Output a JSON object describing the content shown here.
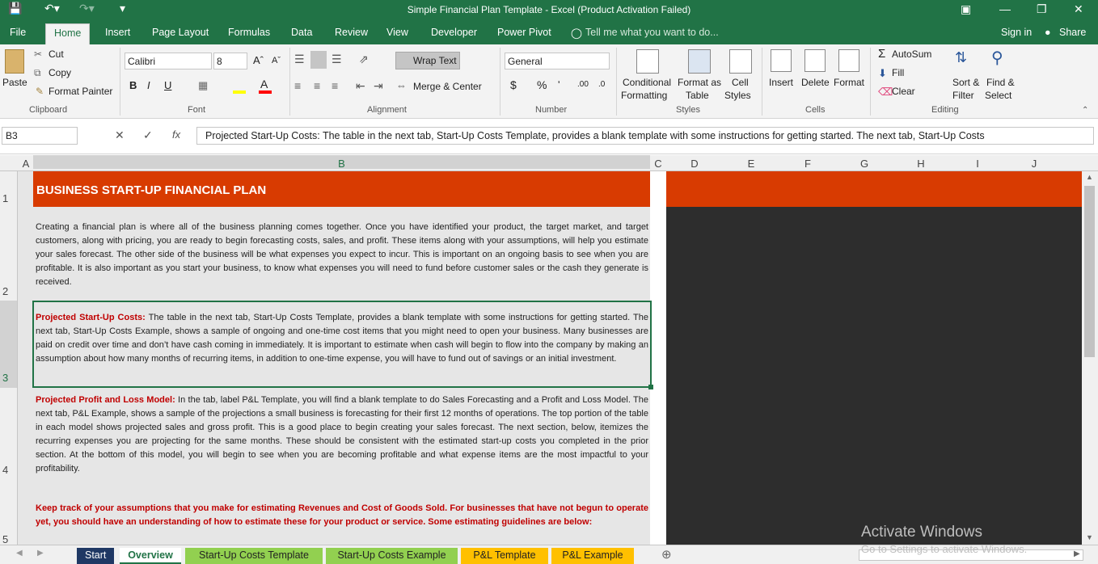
{
  "window": {
    "title": "Simple Financial Plan Template - Excel (Product Activation Failed)"
  },
  "menu": {
    "tabs": [
      "File",
      "Home",
      "Insert",
      "Page Layout",
      "Formulas",
      "Data",
      "Review",
      "View",
      "Developer",
      "Power Pivot"
    ],
    "tell": "Tell me what you want to do...",
    "signin": "Sign in",
    "share": "Share"
  },
  "ribbon": {
    "clipboard": {
      "paste": "Paste",
      "cut": "Cut",
      "copy": "Copy",
      "painter": "Format Painter",
      "label": "Clipboard"
    },
    "font": {
      "name": "Calibri",
      "size": "8",
      "label": "Font"
    },
    "alignment": {
      "wrap": "Wrap Text",
      "merge": "Merge & Center",
      "label": "Alignment"
    },
    "number": {
      "format": "General",
      "label": "Number"
    },
    "styles": {
      "cond1": "Conditional",
      "cond2": "Formatting",
      "fat1": "Format as",
      "fat2": "Table",
      "cs1": "Cell",
      "cs2": "Styles",
      "label": "Styles"
    },
    "cells": {
      "insert": "Insert",
      "delete": "Delete",
      "format": "Format",
      "label": "Cells"
    },
    "editing": {
      "autosum": "AutoSum",
      "fill": "Fill",
      "clear": "Clear",
      "sort1": "Sort &",
      "sort2": "Filter",
      "find1": "Find &",
      "find2": "Select",
      "label": "Editing"
    }
  },
  "formula_bar": {
    "name_box": "B3",
    "formula": "Projected Start-Up Costs: The table in the next tab, Start-Up Costs Template, provides a blank template with some instructions for getting started.  The next tab, Start-Up Costs"
  },
  "columns": [
    "A",
    "B",
    "C",
    "D",
    "E",
    "F",
    "G",
    "H",
    "I",
    "J"
  ],
  "rows": [
    "1",
    "2",
    "3",
    "4",
    "5"
  ],
  "sheet": {
    "title": "BUSINESS START-UP FINANCIAL PLAN",
    "para1": "Creating a financial plan is where all of the business planning comes together. Once you have identified your product, the target market, and target customers, along with pricing, you are ready to begin forecasting costs, sales, and profit. These items along with your assumptions, will help you estimate your sales forecast. The other side of the business will be what expenses you expect to incur. This is important on an ongoing basis to see when you are profitable. It is also important as you start your business, to know what expenses you will need to fund before customer sales or the cash they generate is received.",
    "para2_head": "Projected Start-Up Costs:",
    "para2": " The table in the next tab, Start-Up Costs Template, provides a blank template with some instructions for getting started.  The next tab, Start-Up Costs Example, shows a sample of ongoing and one-time cost items that you might need to open your business. Many businesses are paid on credit over time and don’t have cash coming in immediately. It is important to estimate when cash will begin to flow into the company by making an assumption about how many months of recurring items, in addition to one-time expense, you will have to fund out of savings or an initial investment.",
    "para3_head": "Projected Profit and Loss Model:",
    "para3": " In the tab, label P&L Template, you will find a blank template to do Sales Forecasting and a Profit and Loss Model. The next tab, P&L Example, shows a sample of the projections a small business is forecasting for their first 12 months of operations. The top portion of the table in each model shows projected sales and gross profit. This is a good place to begin creating your sales forecast. The next section, below, itemizes the recurring expenses you are projecting for the same months. These should be consistent with the estimated start-up costs you completed in the prior section. At the bottom of this model, you will begin to see when you are becoming profitable and what expense items are the most impactful to your profitability.",
    "para4": "Keep track of your assumptions that you make for estimating Revenues and Cost of Goods Sold. For businesses that have not begun to operate yet, you should have an understanding of how to estimate these for your product or service.  Some estimating guidelines are below:"
  },
  "watermark": {
    "line1": "Activate Windows",
    "line2": "Go to Settings to activate Windows."
  },
  "sheet_tabs": [
    {
      "label": "Start",
      "color": "#1f3864",
      "text": "#ffffff"
    },
    {
      "label": "Overview",
      "color": "#ffffff",
      "text": "#217346"
    },
    {
      "label": "Start-Up Costs Template",
      "color": "#92d050",
      "text": "#222222"
    },
    {
      "label": "Start-Up Costs Example",
      "color": "#92d050",
      "text": "#222222"
    },
    {
      "label": "P&L Template",
      "color": "#ffc000",
      "text": "#222222"
    },
    {
      "label": "P&L Example",
      "color": "#ffc000",
      "text": "#222222"
    }
  ],
  "colors": {
    "excel_green": "#217346",
    "title_band": "#d83b01",
    "dark_panel": "#2d2d2d"
  }
}
